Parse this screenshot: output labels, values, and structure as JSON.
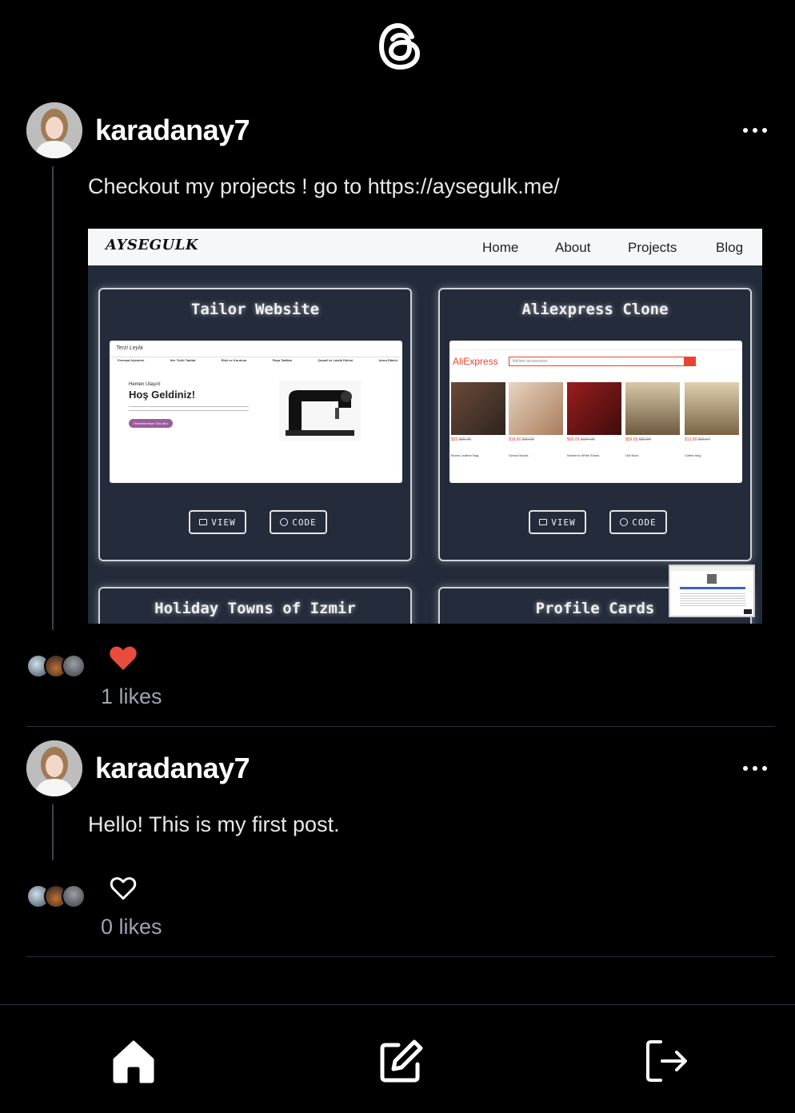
{
  "app": {
    "logo_icon": "threads-logo-icon"
  },
  "posts": [
    {
      "username": "karadanay7",
      "text": "Checkout my projects ! go to https://aysegulk.me/",
      "liked": true,
      "likes_label": "1 likes",
      "link_preview": {
        "brand": "AYSEGULK",
        "nav": [
          "Home",
          "About",
          "Projects",
          "Blog"
        ],
        "cards": [
          {
            "title": "Tailor Website",
            "view_label": "VIEW",
            "code_label": "CODE",
            "shot": {
              "greeting_small": "Hemen Ulaşın!",
              "greeting": "Hoş Geldiniz!",
              "button": "Hizmetlerimize Göz Atın",
              "menu": [
                "Fermuar İşlemleri",
                "Her Türlü Tadilat",
                "Etek ve Kurulum",
                "Paça Tadilatı",
                "Çarşaf ve Lastik Dikimi",
                "Arma Dikimi"
              ]
            }
          },
          {
            "title": "Aliexpress Clone",
            "view_label": "VIEW",
            "code_label": "CODE",
            "shot": {
              "logo": "AliExpress",
              "search_placeholder": "kitchen accessories",
              "products": [
                {
                  "price": "$25",
                  "old": "$35.25",
                  "name": "Brown Leather Bag"
                },
                {
                  "price": "$19.90",
                  "old": "$30.00",
                  "name": "School Books"
                },
                {
                  "price": "$99.09",
                  "old": "$184.95",
                  "name": "Women's White Shoes"
                },
                {
                  "price": "$59.09",
                  "old": "$82.89",
                  "name": "Old Book"
                },
                {
                  "price": "$12.99",
                  "old": "$15.54",
                  "name": "Coffee Mug"
                }
              ]
            }
          },
          {
            "title": "Holiday Towns of Izmir"
          },
          {
            "title": "Profile Cards"
          }
        ]
      }
    },
    {
      "username": "karadanay7",
      "text": "Hello! This is my first post.",
      "liked": false,
      "likes_label": "0 likes"
    }
  ],
  "tabbar": {
    "items": [
      {
        "icon": "home-icon"
      },
      {
        "icon": "compose-icon"
      },
      {
        "icon": "logout-icon"
      }
    ]
  },
  "colors": {
    "background": "#000000",
    "heart_active": "#e74c3c",
    "divider": "#2d3140",
    "preview_bg": "#232b3a"
  }
}
